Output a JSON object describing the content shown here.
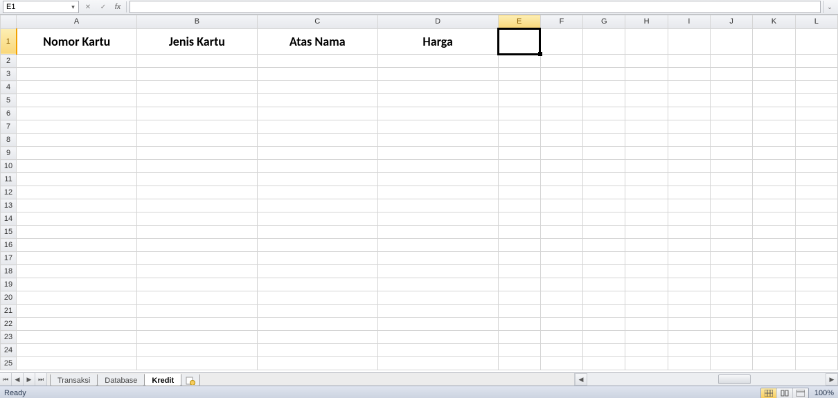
{
  "formula_bar": {
    "cell_ref": "E1",
    "fx_label": "fx",
    "formula_value": ""
  },
  "columns": [
    {
      "letter": "A",
      "class": "wide",
      "selected": false
    },
    {
      "letter": "B",
      "class": "wide",
      "selected": false
    },
    {
      "letter": "C",
      "class": "wide",
      "selected": false
    },
    {
      "letter": "D",
      "class": "wide",
      "selected": false
    },
    {
      "letter": "E",
      "class": "nrw",
      "selected": true
    },
    {
      "letter": "F",
      "class": "nrw",
      "selected": false
    },
    {
      "letter": "G",
      "class": "nrw",
      "selected": false
    },
    {
      "letter": "H",
      "class": "nrw",
      "selected": false
    },
    {
      "letter": "I",
      "class": "nrw",
      "selected": false
    },
    {
      "letter": "J",
      "class": "nrw",
      "selected": false
    },
    {
      "letter": "K",
      "class": "nrw",
      "selected": false
    },
    {
      "letter": "L",
      "class": "nrw",
      "selected": false
    }
  ],
  "rows": 25,
  "selected_row": 1,
  "selected_col_index": 4,
  "row1": {
    "A": "Nomor Kartu",
    "B": "Jenis Kartu",
    "C": "Atas Nama",
    "D": "Harga"
  },
  "sheet_tabs": {
    "items": [
      {
        "label": "Transaksi",
        "active": false
      },
      {
        "label": "Database",
        "active": false
      },
      {
        "label": "Kredit",
        "active": true
      }
    ]
  },
  "statusbar": {
    "ready": "Ready",
    "zoom": "100%"
  }
}
